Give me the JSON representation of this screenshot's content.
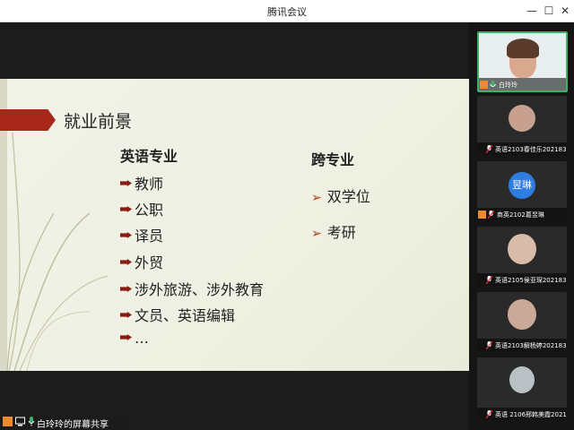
{
  "window": {
    "title": "腾讯会议",
    "controls": {
      "minimize": "—",
      "maximize": "☐",
      "close": "✕"
    }
  },
  "slide": {
    "title": "就业前景",
    "left_column": {
      "heading": "英语专业",
      "items": [
        "教师",
        "公职",
        "译员",
        "外贸",
        "涉外旅游、涉外教育",
        "文员、英语编辑",
        "…"
      ]
    },
    "right_column": {
      "heading": "跨专业",
      "items": [
        "双学位",
        "考研"
      ]
    }
  },
  "share_bar": {
    "label": "白玲玲的屏幕共享"
  },
  "participants": [
    {
      "name": "白玲玲",
      "type": "video",
      "active": true
    },
    {
      "name": "英语2103春佳乐2021833...",
      "type": "video"
    },
    {
      "name": "商英2102葛昱琳",
      "type": "avatar",
      "avatar_text": "昱琳"
    },
    {
      "name": "英语2105侯亚琛2021833...",
      "type": "video"
    },
    {
      "name": "英语2103解杨婷2021833...",
      "type": "video"
    },
    {
      "name": "英语 2106邢韩美霞2021...",
      "type": "video"
    }
  ],
  "colors": {
    "accent_green": "#3fb06c",
    "bullet_red": "#8b1a10",
    "avatar_blue": "#2f7de1",
    "banner_red": "#a8271b"
  }
}
